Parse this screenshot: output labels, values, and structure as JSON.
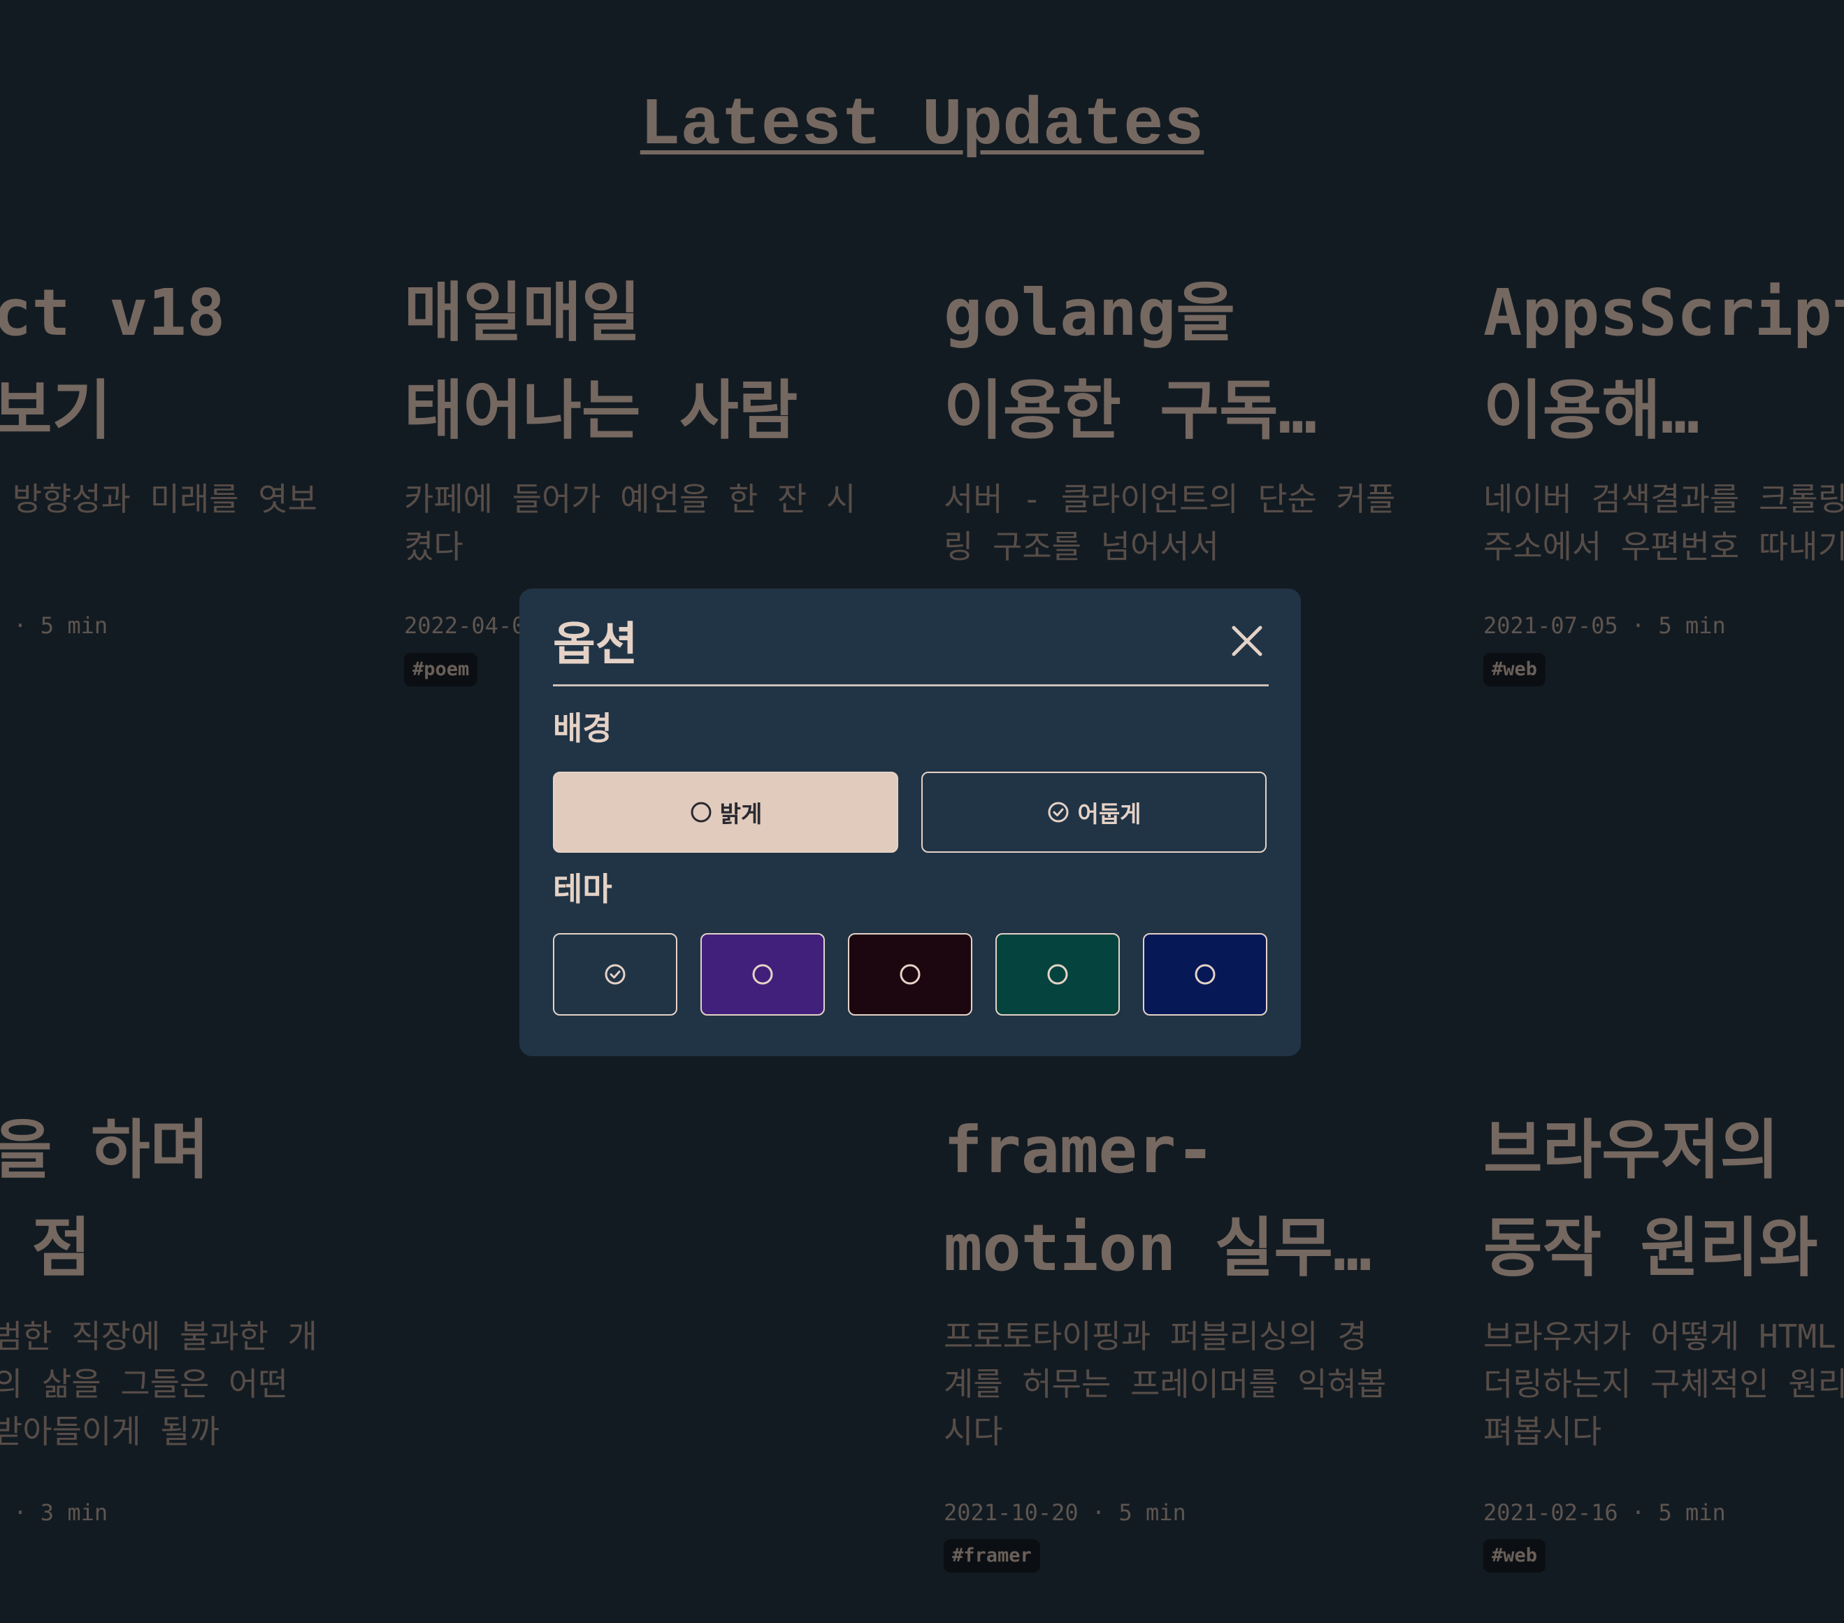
{
  "page": {
    "title": "Latest Updates"
  },
  "cards": [
    {
      "title": "ct v18\n보기",
      "desc": " 방향성과 미래를 엿보",
      "meta": " · 5 min",
      "tag": ""
    },
    {
      "title": "매일매일\n태어나는 사람",
      "desc": "카페에 들어가 예언을 한 잔 시\n켰다",
      "meta": "2022-04-0",
      "tag": "#poem"
    },
    {
      "title": "golang을\n이용한 구독…",
      "desc": "서버 - 클라이언트의 단순 커플\n링 구조를 넘어서서",
      "meta": "",
      "tag": ""
    },
    {
      "title": "AppsScript\n이용해…",
      "desc": "네이버 검색결과를 크롤링\n주소에서 우편번호 따내기",
      "meta": "2021-07-05 · 5 min",
      "tag": "#web"
    },
    {
      "title": "을 하며\n 점",
      "desc": "범한 직장에 불과한 개\n의 삶을 그들은 어떤\n받아들이게 될까",
      "meta": " · 3 min",
      "tag": ""
    },
    {
      "title": "framer-\nmotion 실무…",
      "desc": "프로토타이핑과 퍼블리싱의 경\n계를 허무는 프레이머를 익혀봅\n시다",
      "meta": "2021-10-20 · 5 min",
      "tag": "#framer"
    },
    {
      "title": "브라우저의\n동작 원리와",
      "desc": "브라우저가 어떻게 HTML\n더링하는지 구체적인 원리\n펴봅시다",
      "meta": "2021-02-16 · 5 min",
      "tag": "#web"
    }
  ],
  "modal": {
    "title": "옵션",
    "close_icon": "close-icon",
    "background_label": "배경",
    "background_options": [
      {
        "label": "밝게",
        "selected": false,
        "icon": "circle-icon"
      },
      {
        "label": "어둡게",
        "selected": true,
        "icon": "check-circle-icon"
      }
    ],
    "theme_label": "테마",
    "themes": [
      {
        "color": "#213446",
        "selected": true
      },
      {
        "color": "#40207a",
        "selected": false
      },
      {
        "color": "#1c0710",
        "selected": false
      },
      {
        "color": "#05433e",
        "selected": false
      },
      {
        "color": "#071856",
        "selected": false
      }
    ]
  },
  "colors": {
    "page_bg": "#131b22",
    "text_muted": "#756860",
    "modal_bg": "#213446",
    "accent_light": "#e1cbbd",
    "modal_text": "#e5d2c6"
  }
}
